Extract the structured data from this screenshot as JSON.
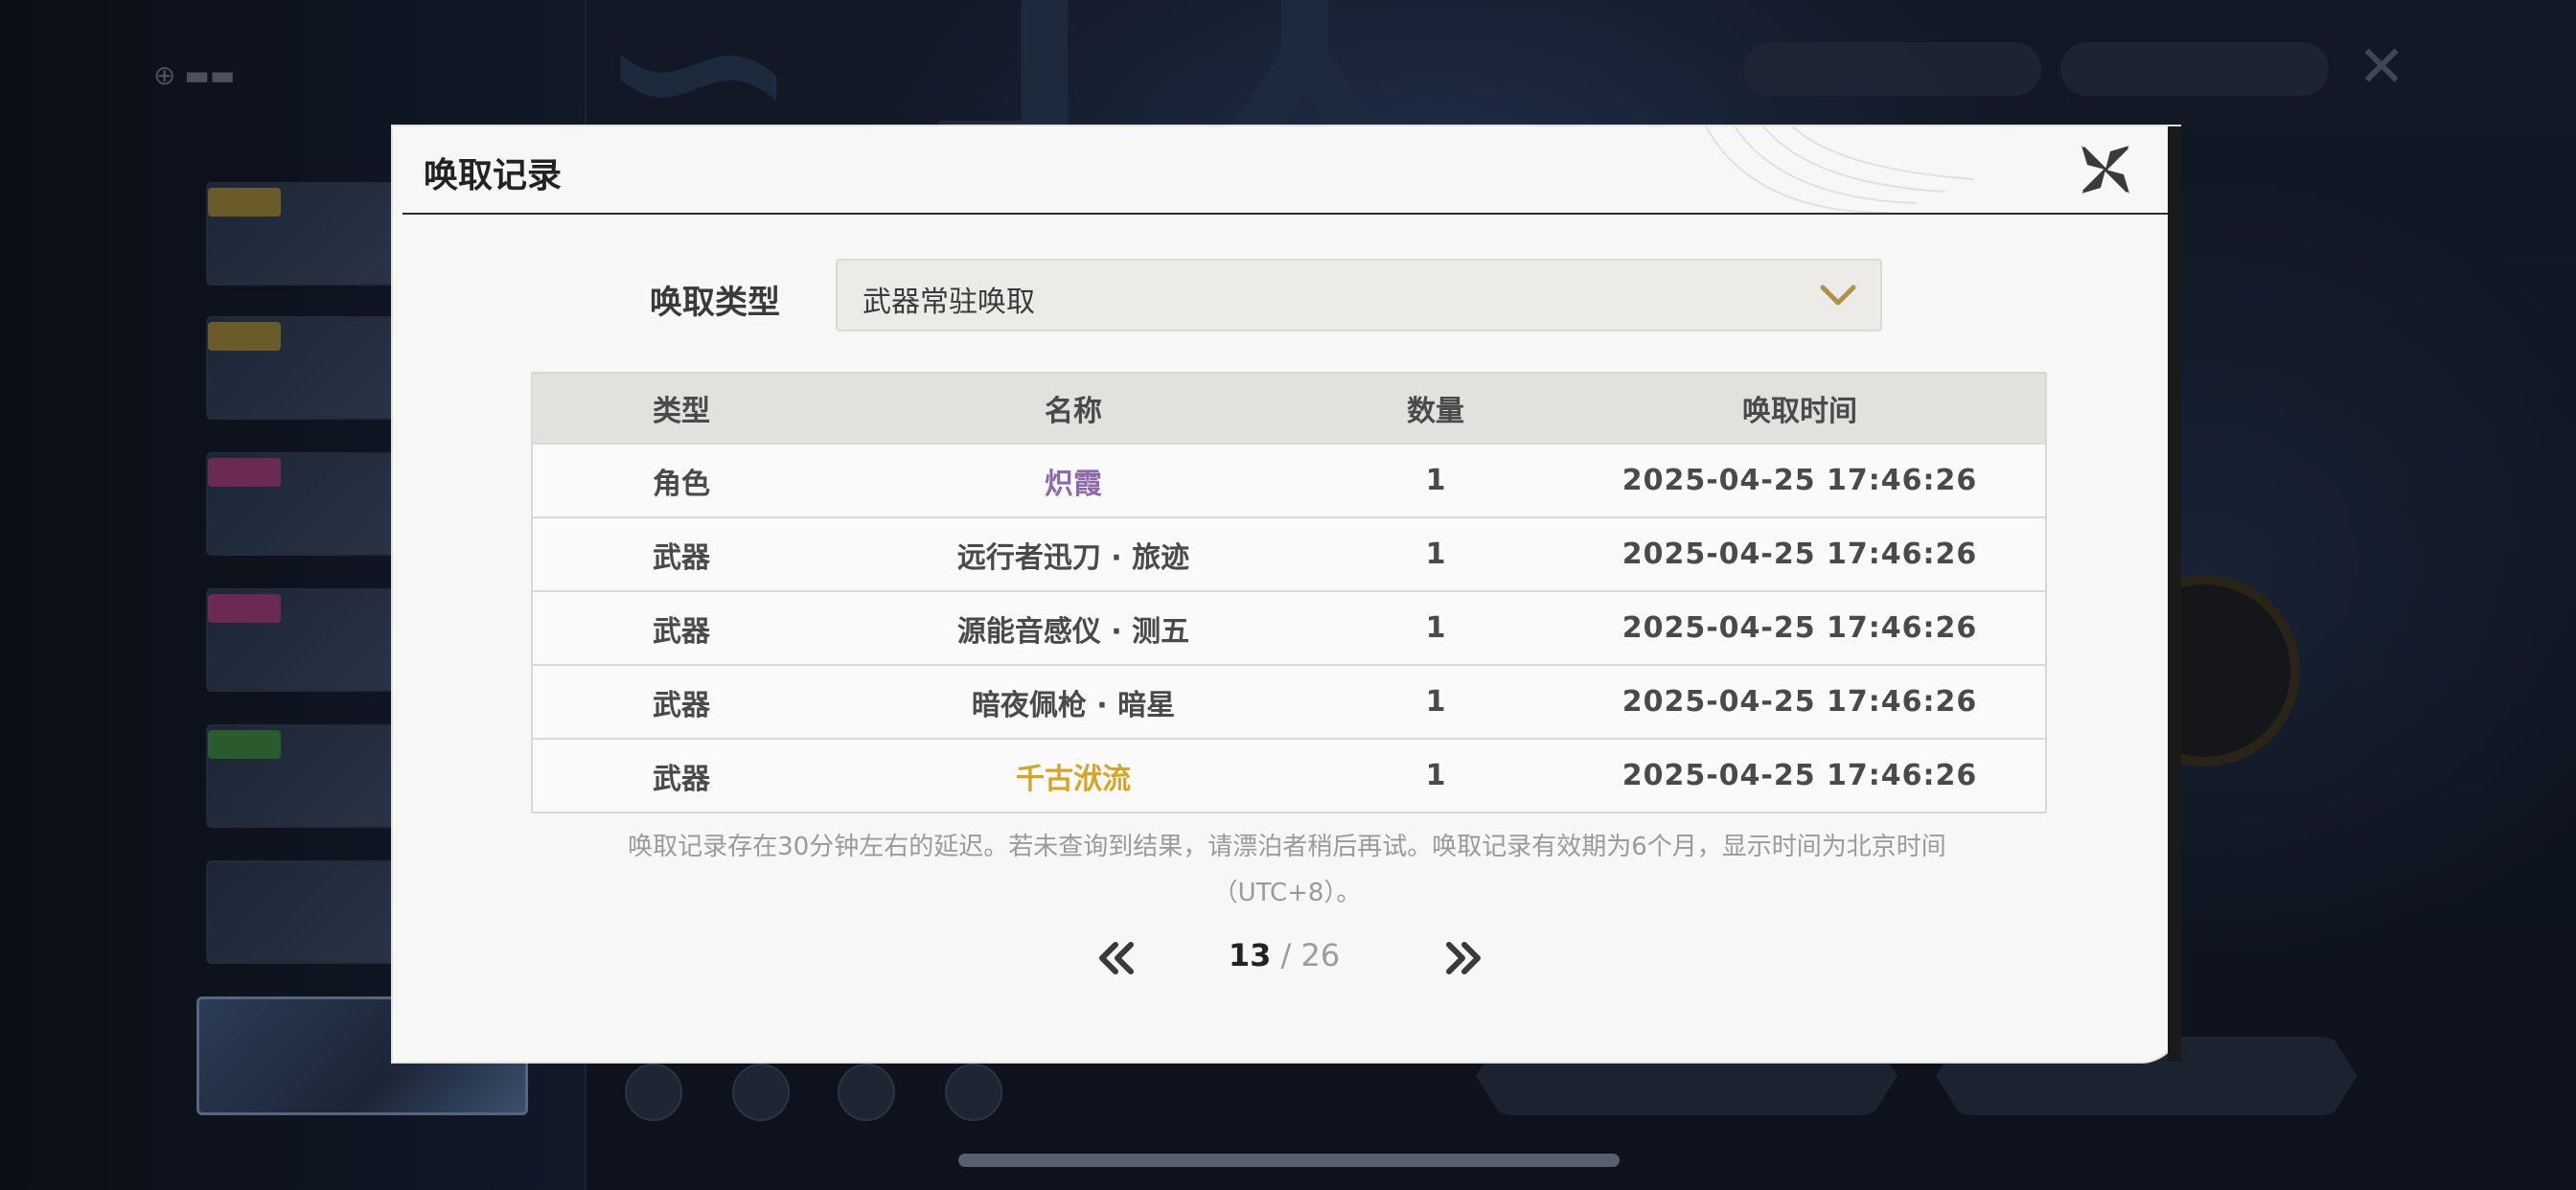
{
  "modal": {
    "title": "唤取记录",
    "filter_label": "唤取类型",
    "filter_value": "武器常驻唤取"
  },
  "table": {
    "headers": [
      "类型",
      "名称",
      "数量",
      "唤取时间"
    ],
    "rows": [
      {
        "type": "角色",
        "name": "炽霞",
        "count": "1",
        "time": "2025-04-25 17:46:26",
        "rarity_color": "#8e6aa8"
      },
      {
        "type": "武器",
        "name": "远行者迅刀 · 旅迹",
        "count": "1",
        "time": "2025-04-25 17:46:26",
        "rarity_color": "#4a4a4a"
      },
      {
        "type": "武器",
        "name": "源能音感仪 · 测五",
        "count": "1",
        "time": "2025-04-25 17:46:26",
        "rarity_color": "#4a4a4a"
      },
      {
        "type": "武器",
        "name": "暗夜佩枪 · 暗星",
        "count": "1",
        "time": "2025-04-25 17:46:26",
        "rarity_color": "#4a4a4a"
      },
      {
        "type": "武器",
        "name": "千古洑流",
        "count": "1",
        "time": "2025-04-25 17:46:26",
        "rarity_color": "#d4a52b"
      }
    ]
  },
  "notice": {
    "line1": "唤取记录存在30分钟左右的延迟。若未查询到结果，请漂泊者稍后再试。唤取记录有效期为6个月，显示时间为北京时间",
    "line2": "（UTC+8）。"
  },
  "pagination": {
    "current": "13",
    "separator": "/",
    "total": "26"
  },
  "colors": {
    "accent_gold": "#b0904a",
    "rule": "#2e2e2e"
  }
}
